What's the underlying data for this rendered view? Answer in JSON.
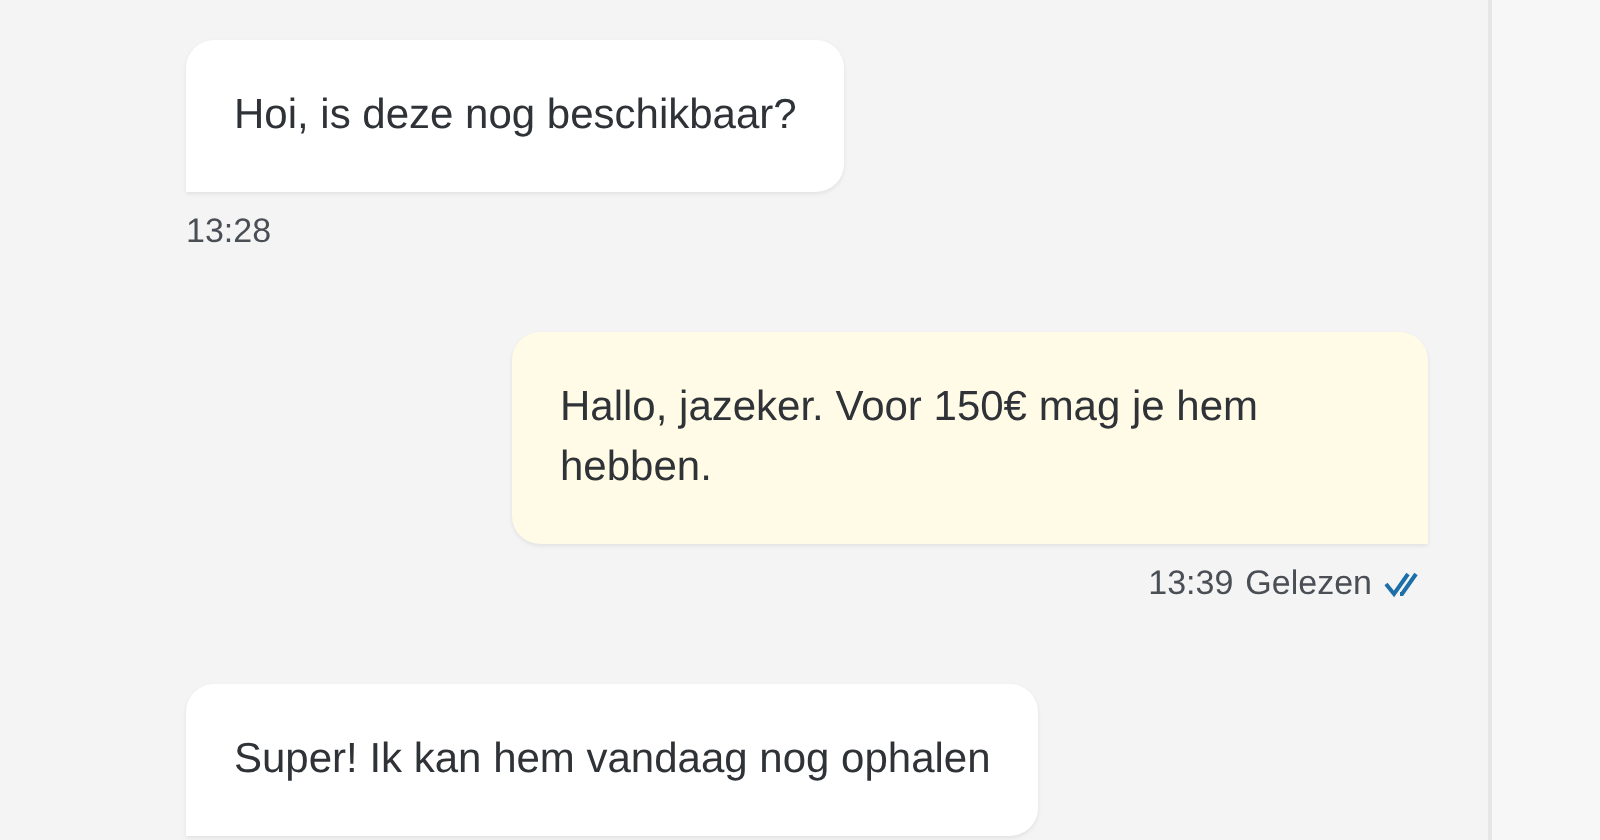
{
  "messages": [
    {
      "kind": "incoming",
      "text": "Hoi, is deze nog beschikbaar?",
      "time": "13:28"
    },
    {
      "kind": "outgoing",
      "text": "Hallo, jazeker. Voor 150€ mag je hem hebben.",
      "time": "13:39",
      "status": "Gelezen",
      "read": true
    },
    {
      "kind": "incoming",
      "text": "Super! Ik kan hem vandaag nog ophalen"
    }
  ]
}
